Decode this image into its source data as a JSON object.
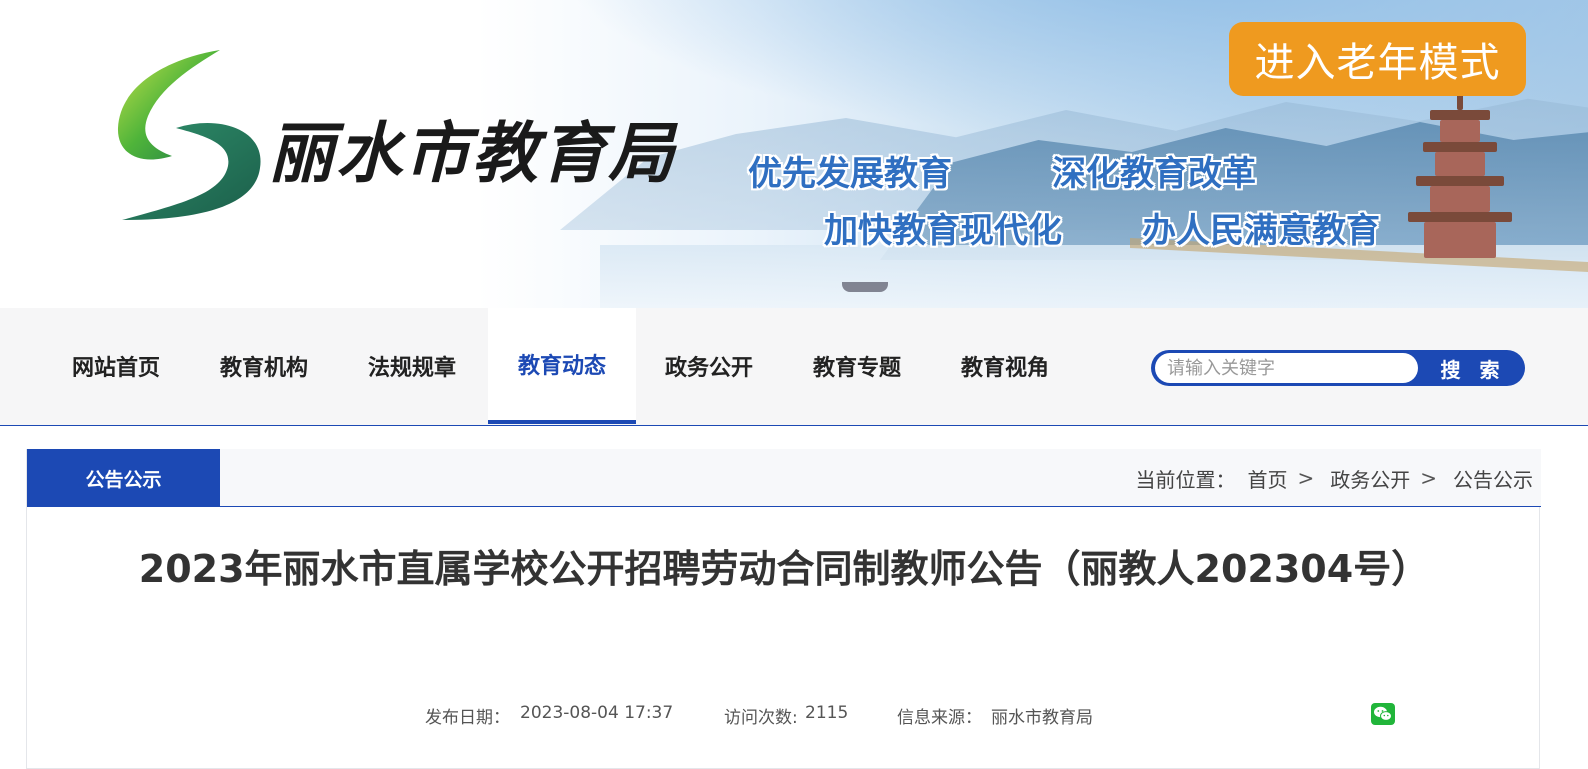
{
  "header": {
    "site_title": "丽水市教育局",
    "elder_mode_button": "进入老年模式",
    "slogans": [
      "优先发展教育",
      "深化教育改革",
      "加快教育现代化",
      "办人民满意教育"
    ],
    "logo_icon": "green-s-swoosh-icon",
    "colors": {
      "logo_green": "#3aa83a",
      "slogan_blue": "#2f6fc1",
      "elder_orange": "#ef9a1f"
    }
  },
  "nav": {
    "items": [
      "网站首页",
      "教育机构",
      "法规规章",
      "教育动态",
      "政务公开",
      "教育专题",
      "教育视角"
    ],
    "active_index": 3,
    "search_placeholder": "请输入关键字",
    "search_button": "搜 索",
    "colors": {
      "accent": "#1c49b4"
    }
  },
  "panel": {
    "tab_label": "公告公示",
    "breadcrumb_prefix": "当前位置：",
    "breadcrumb": [
      "首页",
      "政务公开",
      "公告公示"
    ]
  },
  "article": {
    "title": "2023年丽水市直属学校公开招聘劳动合同制教师公告（丽教人202304号）",
    "publish_label": "发布日期：",
    "publish_date": "2023-08-04  17:37",
    "visits_label": "访问次数:",
    "visits": "2115",
    "source_label": "信息来源：",
    "source": "丽水市教育局",
    "share_icon": "wechat-icon"
  }
}
